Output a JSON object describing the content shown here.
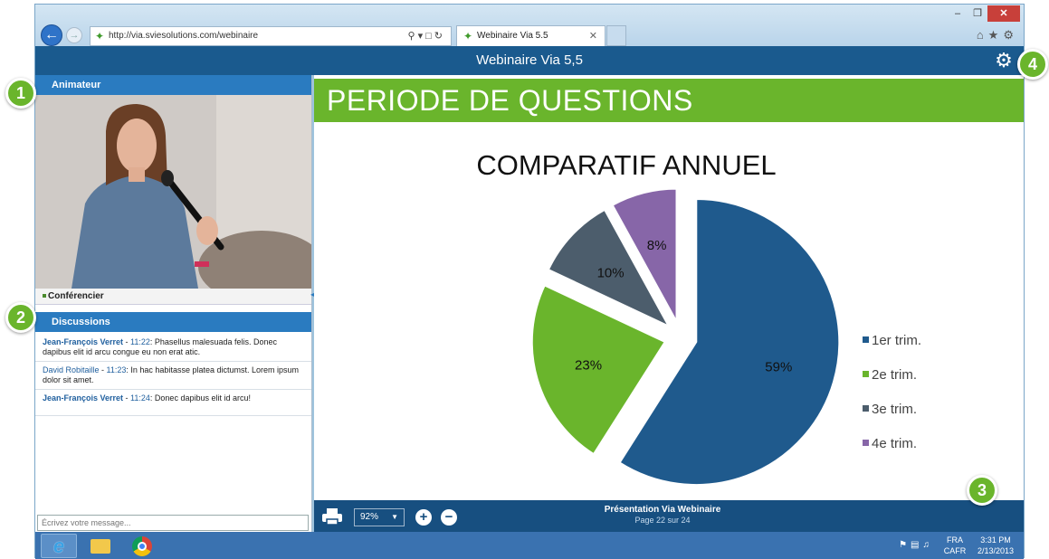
{
  "browser": {
    "url": "http://via.sviesolutions.com/webinaire",
    "tab_title": "Webinaire Via 5.5",
    "win_minimize": "–",
    "win_restore": "❐",
    "win_close": "✕"
  },
  "app": {
    "title": "Webinaire Via 5,5"
  },
  "left_panel": {
    "presenter_header": "Animateur",
    "presenter_label": "Conférencier",
    "discussions_header": "Discussions",
    "messages": [
      {
        "author": "Jean-François Verret",
        "time": "11:22",
        "text": "Phasellus malesuada felis. Donec dapibus elit id arcu congue eu non erat atic."
      },
      {
        "author": "David Robitaille",
        "time": "11:23",
        "text": "In hac habitasse platea dictumst. Lorem ipsum dolor sit amet."
      },
      {
        "author": "Jean-François Verret",
        "time": "11:24",
        "text": "Donec dapibus elit id arcu!"
      }
    ],
    "compose_placeholder": "Écrivez votre message..."
  },
  "slide": {
    "banner": "PERIODE DE QUESTIONS"
  },
  "chart_data": {
    "type": "pie",
    "title": "COMPARATIF ANNUEL",
    "categories": [
      "1er trim.",
      "2e trim.",
      "3e trim.",
      "4e trim."
    ],
    "values": [
      59,
      23,
      10,
      8
    ],
    "labels": [
      "59%",
      "23%",
      "10%",
      "8%"
    ],
    "colors": [
      "#1f5a8d",
      "#6ab52c",
      "#4c5d6c",
      "#8766a8"
    ],
    "legend": "right",
    "exploded": true
  },
  "toolbar": {
    "zoom": "92%",
    "presentation_title": "Présentation Via Webinaire",
    "page_info": "Page 22 sur 24"
  },
  "taskbar": {
    "lang_top": "FRA",
    "lang_bottom": "CAFR",
    "time": "3:31 PM",
    "date": "2/13/2013"
  },
  "callouts": [
    "1",
    "2",
    "3",
    "4"
  ]
}
